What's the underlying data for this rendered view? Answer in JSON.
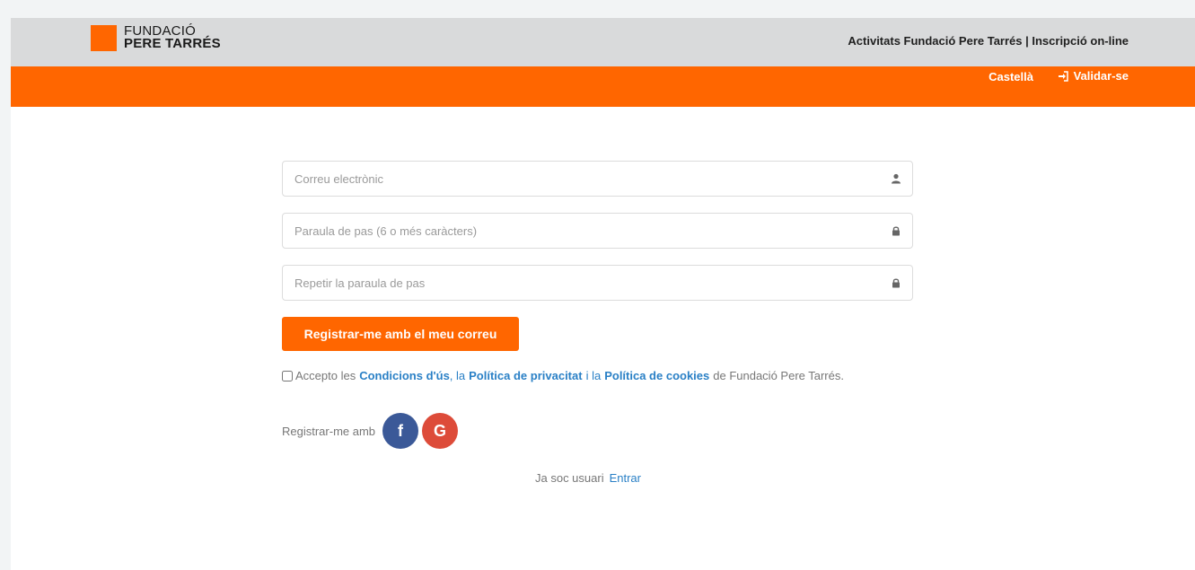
{
  "header": {
    "logo_line1": "FUNDACIÓ",
    "logo_line2": "PERE TARRÉS",
    "title": "Activitats Fundació Pere Tarrés | Inscripció on-line"
  },
  "nav": {
    "language": "Castellà",
    "login": "Validar-se",
    "login_icon": "sign-in-icon"
  },
  "form": {
    "email_placeholder": "Correu electrònic",
    "email_value": "",
    "email_icon": "user-icon",
    "password_placeholder": "Paraula de pas (6 o més caràcters)",
    "password_value": "",
    "password_icon": "lock-icon",
    "repeat_placeholder": "Repetir la paraula de pas",
    "repeat_value": "",
    "repeat_icon": "lock-icon",
    "submit_label": "Registrar-me amb el meu correu"
  },
  "terms": {
    "prefix": "Accepto les",
    "conditions_link": "Condicions d'ús",
    "comma_la": ", la",
    "privacy_link": "Política de privacitat",
    "i_la": "i la",
    "cookies_link": "Política de cookies",
    "suffix": "de Fundació Pere Tarrés.",
    "checked": false
  },
  "social": {
    "label": "Registrar-me amb",
    "facebook_glyph": "f",
    "google_glyph": "G"
  },
  "footer": {
    "already_text": "Ja soc usuari",
    "enter_link": "Entrar"
  },
  "colors": {
    "brand_orange": "#ff6600",
    "header_gray": "#d9dadb",
    "link_blue": "#2a80c6",
    "facebook": "#3b5998",
    "google": "#dd4b39"
  }
}
